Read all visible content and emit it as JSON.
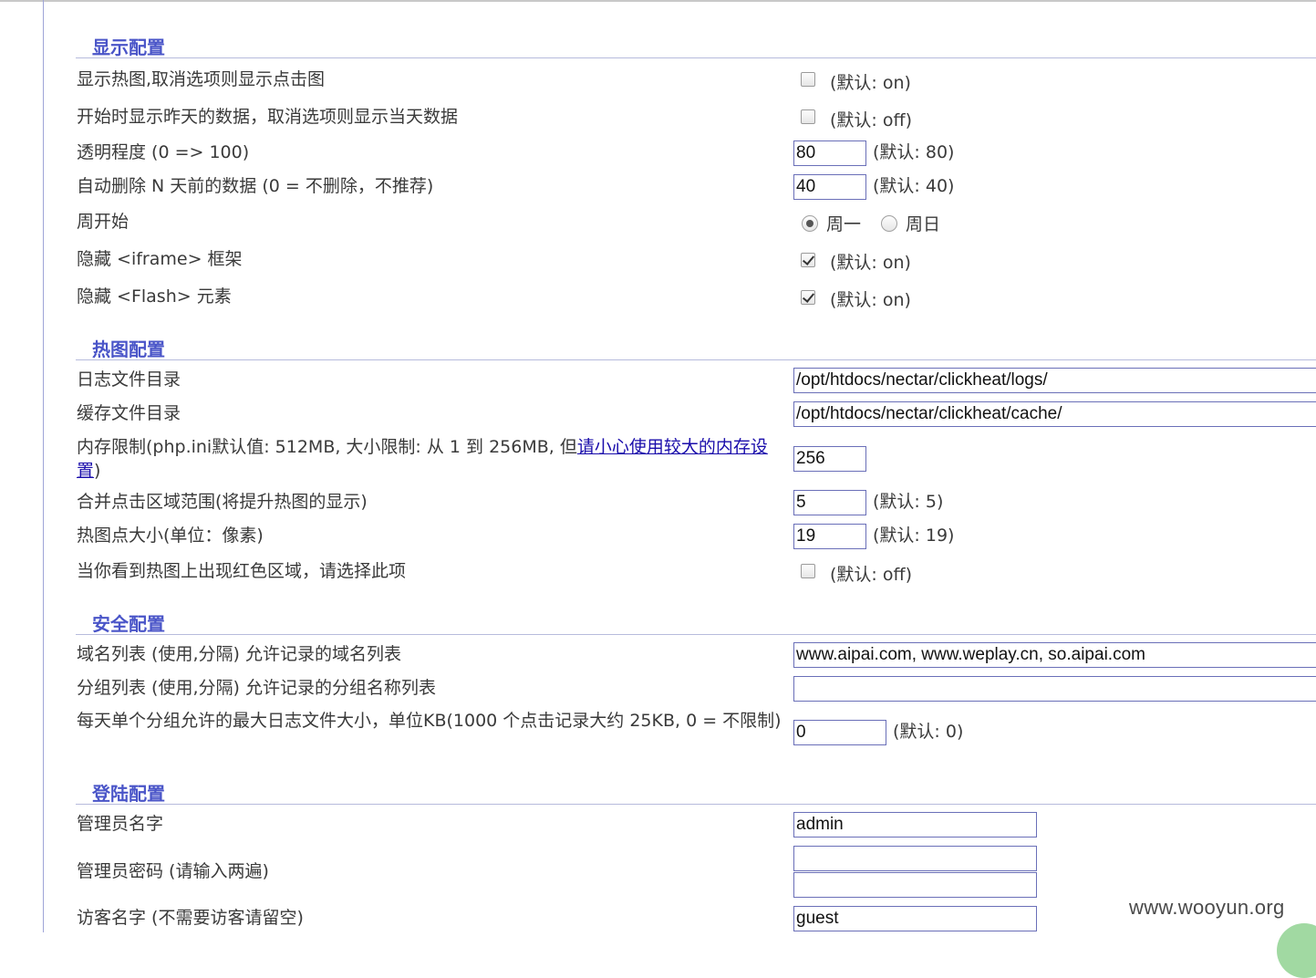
{
  "sections": {
    "display": {
      "title": "显示配置",
      "rows": {
        "heatmap": {
          "label": "显示热图,取消选项则显示点击图",
          "checked": false,
          "hint": "(默认: on)"
        },
        "yesterday": {
          "label": "开始时显示昨天的数据，取消选项则显示当天数据",
          "checked": false,
          "hint": "(默认: off)"
        },
        "opacity": {
          "label": "透明程度 (0 => 100)",
          "value": "80",
          "hint": "(默认: 80)"
        },
        "autodelete": {
          "label": "自动删除 N 天前的数据 (0 = 不删除，不推荐)",
          "value": "40",
          "hint": "(默认: 40)"
        },
        "weekstart": {
          "label": "周开始",
          "option1": "周一",
          "option2": "周日",
          "selected": "周一"
        },
        "iframe": {
          "label": "隐藏 <iframe> 框架",
          "checked": true,
          "hint": "(默认: on)"
        },
        "flash": {
          "label": "隐藏 <Flash> 元素",
          "checked": true,
          "hint": "(默认: on)"
        }
      }
    },
    "heatmap": {
      "title": "热图配置",
      "rows": {
        "logdir": {
          "label": "日志文件目录",
          "value": "/opt/htdocs/nectar/clickheat/logs/"
        },
        "cachedir": {
          "label": "缓存文件目录",
          "value": "/opt/htdocs/nectar/clickheat/cache/"
        },
        "memory": {
          "label_prefix": "内存限制(php.ini默认值: 512MB, 大小限制: 从 1 到 256MB, 但",
          "link_text": "请小心使用较大的内存设置",
          "label_suffix": ")",
          "value": "256"
        },
        "merge": {
          "label": "合并点击区域范围(将提升热图的显示)",
          "value": "5",
          "hint": "(默认: 5)"
        },
        "dotsize": {
          "label": "热图点大小(单位：像素)",
          "value": "19",
          "hint": "(默认: 19)"
        },
        "redzone": {
          "label": "当你看到热图上出现红色区域，请选择此项",
          "checked": false,
          "hint": "(默认: off)"
        }
      }
    },
    "security": {
      "title": "安全配置",
      "rows": {
        "domains": {
          "label": "域名列表 (使用,分隔) 允许记录的域名列表",
          "value": "www.aipai.com, www.weplay.cn, so.aipai.com"
        },
        "groups": {
          "label": "分组列表 (使用,分隔) 允许记录的分组名称列表",
          "value": ""
        },
        "maxlog": {
          "label": "每天单个分组允许的最大日志文件大小，单位KB(1000 个点击记录大约 25KB, 0 = 不限制)",
          "value": "0",
          "hint": "(默认: 0)"
        }
      }
    },
    "login": {
      "title": "登陆配置",
      "rows": {
        "adminname": {
          "label": "管理员名字",
          "value": "admin"
        },
        "adminpass": {
          "label": "管理员密码 (请输入两遍)",
          "value1": "",
          "value2": ""
        },
        "guestname": {
          "label": "访客名字 (不需要访客请留空)",
          "value": "guest"
        }
      }
    }
  },
  "watermark": "www.wooyun.org",
  "colors": {
    "section_title": "#4a55c8",
    "link": "#1a0dab",
    "field_border": "#6a6fb8"
  }
}
